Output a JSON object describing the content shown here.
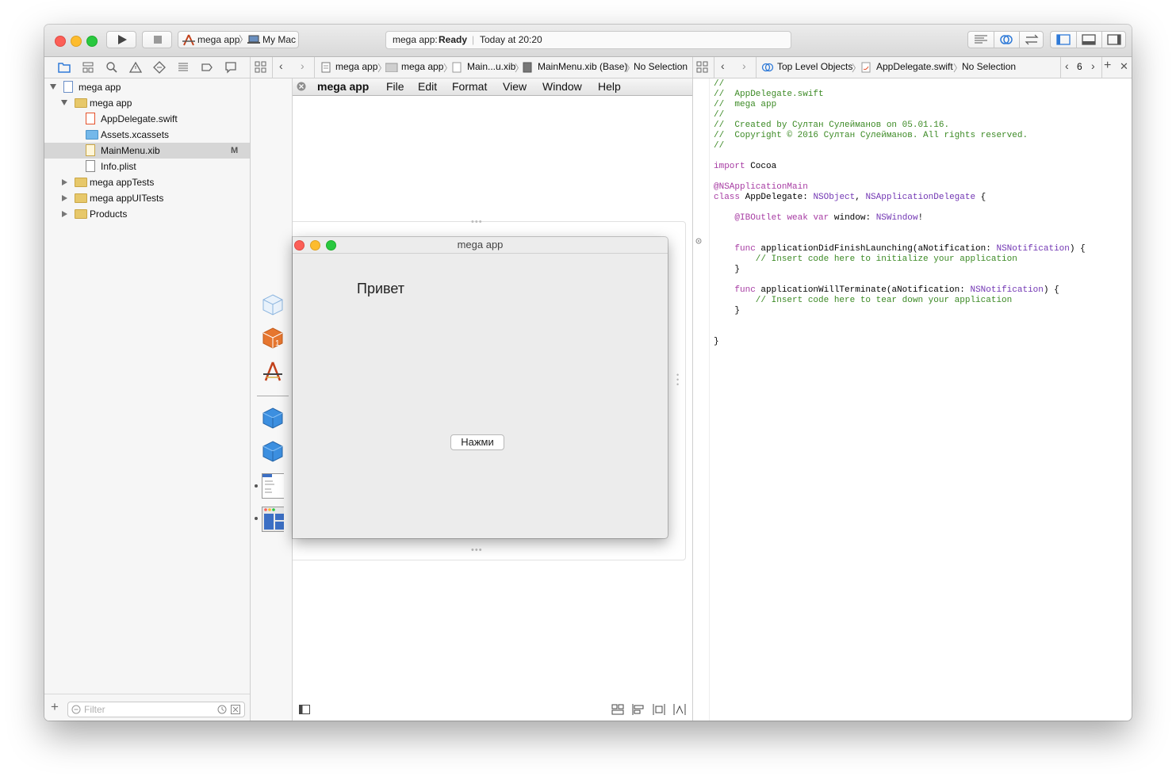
{
  "toolbar": {
    "scheme_name": "mega app",
    "destination": "My Mac",
    "activity_project": "mega app:",
    "activity_status": "Ready",
    "activity_time": "Today at 20:20"
  },
  "ib_nav": {
    "breadcrumbs": [
      "mega app",
      "mega app",
      "Main...u.xib",
      "MainMenu.xib (Base)",
      "No Selection"
    ]
  },
  "editor_nav": {
    "breadcrumbs": [
      "Top Level Objects",
      "AppDelegate.swift",
      "No Selection"
    ],
    "counter": "6"
  },
  "navigator": {
    "items": [
      {
        "label": "mega app",
        "kind": "project",
        "level": 0,
        "expanded": true,
        "badge": ""
      },
      {
        "label": "mega app",
        "kind": "folder",
        "level": 1,
        "expanded": true,
        "badge": ""
      },
      {
        "label": "AppDelegate.swift",
        "kind": "swift",
        "level": 2,
        "badge": ""
      },
      {
        "label": "Assets.xcassets",
        "kind": "assets",
        "level": 2,
        "badge": ""
      },
      {
        "label": "MainMenu.xib",
        "kind": "xib",
        "level": 2,
        "badge": "M",
        "selected": true
      },
      {
        "label": "Info.plist",
        "kind": "plist",
        "level": 2,
        "badge": ""
      },
      {
        "label": "mega appTests",
        "kind": "folder",
        "level": 1,
        "expanded": false,
        "badge": ""
      },
      {
        "label": "mega appUITests",
        "kind": "folder",
        "level": 1,
        "expanded": false,
        "badge": ""
      },
      {
        "label": "Products",
        "kind": "folder",
        "level": 1,
        "expanded": false,
        "badge": ""
      }
    ],
    "filter_placeholder": "Filter"
  },
  "ib_menu": {
    "app_name": "mega app",
    "items": [
      "File",
      "Edit",
      "Format",
      "View",
      "Window",
      "Help"
    ]
  },
  "app_window": {
    "title": "mega app",
    "label_text": "Привет",
    "button_text": "Нажми"
  },
  "code_lines": [
    {
      "segments": [
        {
          "t": "//",
          "c": "com"
        }
      ]
    },
    {
      "segments": [
        {
          "t": "//  AppDelegate.swift",
          "c": "com"
        }
      ]
    },
    {
      "segments": [
        {
          "t": "//  mega app",
          "c": "com"
        }
      ]
    },
    {
      "segments": [
        {
          "t": "//",
          "c": "com"
        }
      ]
    },
    {
      "segments": [
        {
          "t": "//  Created by Султан Сулейманов on 05.01.16.",
          "c": "com"
        }
      ]
    },
    {
      "segments": [
        {
          "t": "//  Copyright © 2016 Султан Сулейманов. All rights reserved.",
          "c": "com"
        }
      ]
    },
    {
      "segments": [
        {
          "t": "//",
          "c": "com"
        }
      ]
    },
    {
      "segments": []
    },
    {
      "segments": [
        {
          "t": "import",
          "c": "key"
        },
        {
          "t": " Cocoa",
          "c": ""
        }
      ]
    },
    {
      "segments": []
    },
    {
      "segments": [
        {
          "t": "@NSApplicationMain",
          "c": "attr"
        }
      ]
    },
    {
      "segments": [
        {
          "t": "class",
          "c": "key"
        },
        {
          "t": " AppDelegate: ",
          "c": ""
        },
        {
          "t": "NSObject",
          "c": "type"
        },
        {
          "t": ", ",
          "c": ""
        },
        {
          "t": "NSApplicationDelegate",
          "c": "type"
        },
        {
          "t": " {",
          "c": ""
        }
      ]
    },
    {
      "segments": []
    },
    {
      "segments": [
        {
          "t": "    ",
          "c": ""
        },
        {
          "t": "@IBOutlet",
          "c": "attr"
        },
        {
          "t": " ",
          "c": ""
        },
        {
          "t": "weak",
          "c": "key"
        },
        {
          "t": " ",
          "c": ""
        },
        {
          "t": "var",
          "c": "key"
        },
        {
          "t": " window: ",
          "c": ""
        },
        {
          "t": "NSWindow",
          "c": "type"
        },
        {
          "t": "!",
          "c": ""
        }
      ]
    },
    {
      "segments": []
    },
    {
      "segments": []
    },
    {
      "segments": [
        {
          "t": "    ",
          "c": ""
        },
        {
          "t": "func",
          "c": "key"
        },
        {
          "t": " applicationDidFinishLaunching(aNotification: ",
          "c": ""
        },
        {
          "t": "NSNotification",
          "c": "type"
        },
        {
          "t": ") {",
          "c": ""
        }
      ]
    },
    {
      "segments": [
        {
          "t": "        // Insert code here to initialize your application",
          "c": "com"
        }
      ]
    },
    {
      "segments": [
        {
          "t": "    }",
          "c": ""
        }
      ]
    },
    {
      "segments": []
    },
    {
      "segments": [
        {
          "t": "    ",
          "c": ""
        },
        {
          "t": "func",
          "c": "key"
        },
        {
          "t": " applicationWillTerminate(aNotification: ",
          "c": ""
        },
        {
          "t": "NSNotification",
          "c": "type"
        },
        {
          "t": ") {",
          "c": ""
        }
      ]
    },
    {
      "segments": [
        {
          "t": "        // Insert code here to tear down your application",
          "c": "com"
        }
      ]
    },
    {
      "segments": [
        {
          "t": "    }",
          "c": ""
        }
      ]
    },
    {
      "segments": []
    },
    {
      "segments": []
    },
    {
      "segments": [
        {
          "t": "}",
          "c": ""
        }
      ]
    }
  ],
  "colors": {
    "comment": "#3c8a25",
    "keyword": "#a73ca3",
    "type": "#7236b3",
    "selection": "#d6d6d6",
    "accent": "#2f7ad8"
  }
}
